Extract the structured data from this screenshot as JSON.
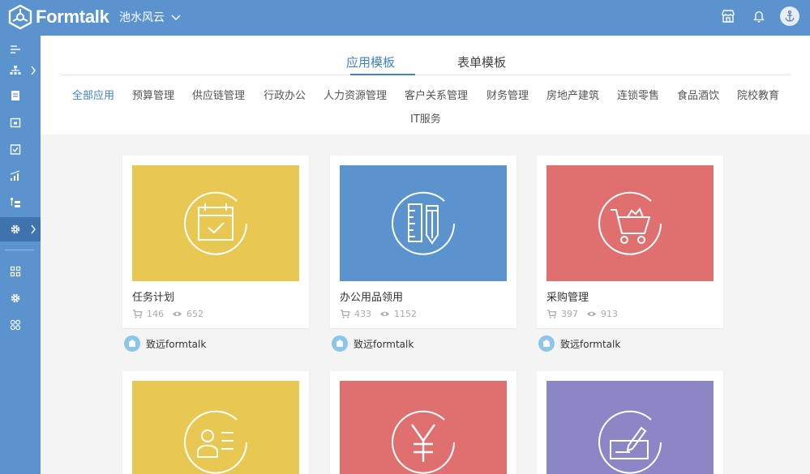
{
  "app": {
    "name": "Formtalk",
    "workspace": "池水风云"
  },
  "tabs": [
    {
      "label": "应用模板",
      "active": true
    },
    {
      "label": "表单模板",
      "active": false
    }
  ],
  "categories": [
    {
      "label": "全部应用",
      "active": true
    },
    {
      "label": "预算管理"
    },
    {
      "label": "供应链管理"
    },
    {
      "label": "行政办公"
    },
    {
      "label": "人力资源管理"
    },
    {
      "label": "客户关系管理"
    },
    {
      "label": "财务管理"
    },
    {
      "label": "房地产建筑"
    },
    {
      "label": "连锁零售"
    },
    {
      "label": "食品酒饮"
    },
    {
      "label": "院校教育"
    },
    {
      "label": "IT服务"
    }
  ],
  "sidebar": {
    "items": [
      {
        "icon": "menu-list-icon"
      },
      {
        "icon": "org-chart-icon",
        "has_arrow": true
      },
      {
        "icon": "document-icon"
      },
      {
        "icon": "calendar-icon"
      },
      {
        "icon": "checklist-icon"
      },
      {
        "icon": "bar-chart-icon"
      },
      {
        "icon": "tree-list-icon"
      },
      {
        "icon": "gear-icon",
        "has_arrow": true,
        "active": true
      },
      {
        "icon": "apps-grid-icon"
      },
      {
        "icon": "gear-small-icon"
      },
      {
        "icon": "modules-icon"
      }
    ]
  },
  "templates": [
    {
      "title": "任务计划",
      "uses": "146",
      "views": "652",
      "author": "致远formtalk",
      "color": "#e8c853",
      "icon": "calendar-check-icon"
    },
    {
      "title": "办公用品领用",
      "uses": "433",
      "views": "1152",
      "author": "致远formtalk",
      "color": "#5b93cf",
      "icon": "ruler-pencil-icon"
    },
    {
      "title": "采购管理",
      "uses": "397",
      "views": "913",
      "author": "致远formtalk",
      "color": "#e07070",
      "icon": "shopping-cart-icon"
    },
    {
      "color": "#e8c853",
      "icon": "id-card-icon"
    },
    {
      "color": "#e07070",
      "icon": "yen-icon"
    },
    {
      "color": "#8b87c6",
      "icon": "cheque-icon"
    }
  ],
  "colors": {
    "primary": "#5b93cf",
    "accent": "#3f84c8"
  }
}
